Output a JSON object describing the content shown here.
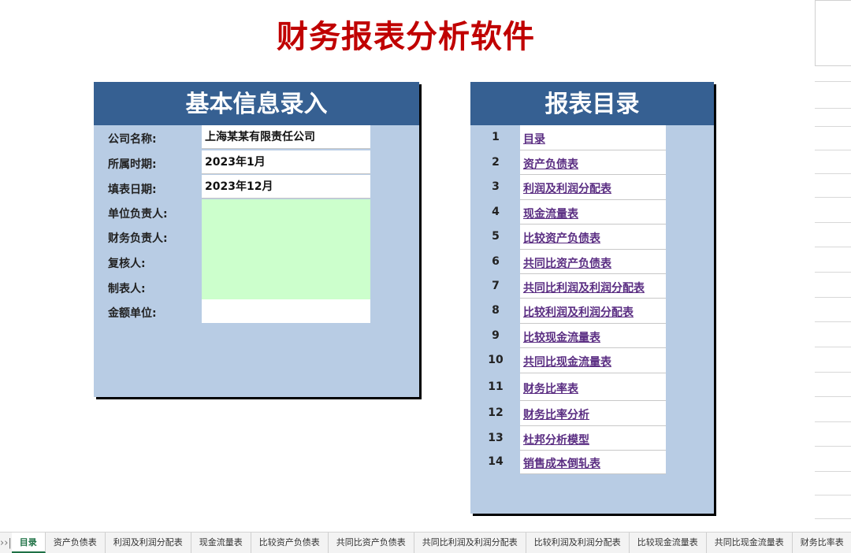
{
  "title": "财务报表分析软件",
  "info": {
    "header": "基本信息录入",
    "fields": [
      {
        "label": "公司名称:",
        "value": "上海某某有限责任公司"
      },
      {
        "label": "所属时期:",
        "value": "2023年1月"
      },
      {
        "label": "填表日期:",
        "value": "2023年12月"
      },
      {
        "label": "单位负责人:",
        "value": ""
      },
      {
        "label": "财务负责人:",
        "value": ""
      },
      {
        "label": "复核人:",
        "value": ""
      },
      {
        "label": "制表人:",
        "value": ""
      },
      {
        "label": "金额单位:",
        "value": ""
      }
    ]
  },
  "toc": {
    "header": "报表目录",
    "items": [
      {
        "num": "1",
        "label": "目录"
      },
      {
        "num": "2",
        "label": "资产负债表"
      },
      {
        "num": "3",
        "label": "利润及利润分配表"
      },
      {
        "num": "4",
        "label": "现金流量表"
      },
      {
        "num": "5",
        "label": "比较资产负债表"
      },
      {
        "num": "6",
        "label": "共同比资产负债表"
      },
      {
        "num": "7",
        "label": "共同比利润及利润分配表"
      },
      {
        "num": "8",
        "label": "比较利润及利润分配表"
      },
      {
        "num": "9",
        "label": "比较现金流量表"
      },
      {
        "num": "10",
        "label": "共同比现金流量表"
      },
      {
        "num": "11",
        "label": "财务比率表"
      },
      {
        "num": "12",
        "label": "财务比率分析"
      },
      {
        "num": "13",
        "label": "杜邦分析模型"
      },
      {
        "num": "14",
        "label": "销售成本倒轧表"
      }
    ]
  },
  "sheet_nav": {
    "next": "›",
    "last": "›|"
  },
  "sheet_tabs": [
    {
      "label": "目录",
      "active": true
    },
    {
      "label": "资产负债表"
    },
    {
      "label": "利润及利润分配表"
    },
    {
      "label": "现金流量表"
    },
    {
      "label": "比较资产负债表"
    },
    {
      "label": "共同比资产负债表"
    },
    {
      "label": "共同比利润及利润分配表"
    },
    {
      "label": "比较利润及利润分配表"
    },
    {
      "label": "比较现金流量表"
    },
    {
      "label": "共同比现金流量表"
    },
    {
      "label": "财务比率表"
    }
  ],
  "colors": {
    "title": "#c00000",
    "header_bg": "#366092",
    "panel_bg": "#b8cce4",
    "input_green": "#ccffcc",
    "link": "#5a2d82",
    "active_tab": "#1e7145"
  }
}
